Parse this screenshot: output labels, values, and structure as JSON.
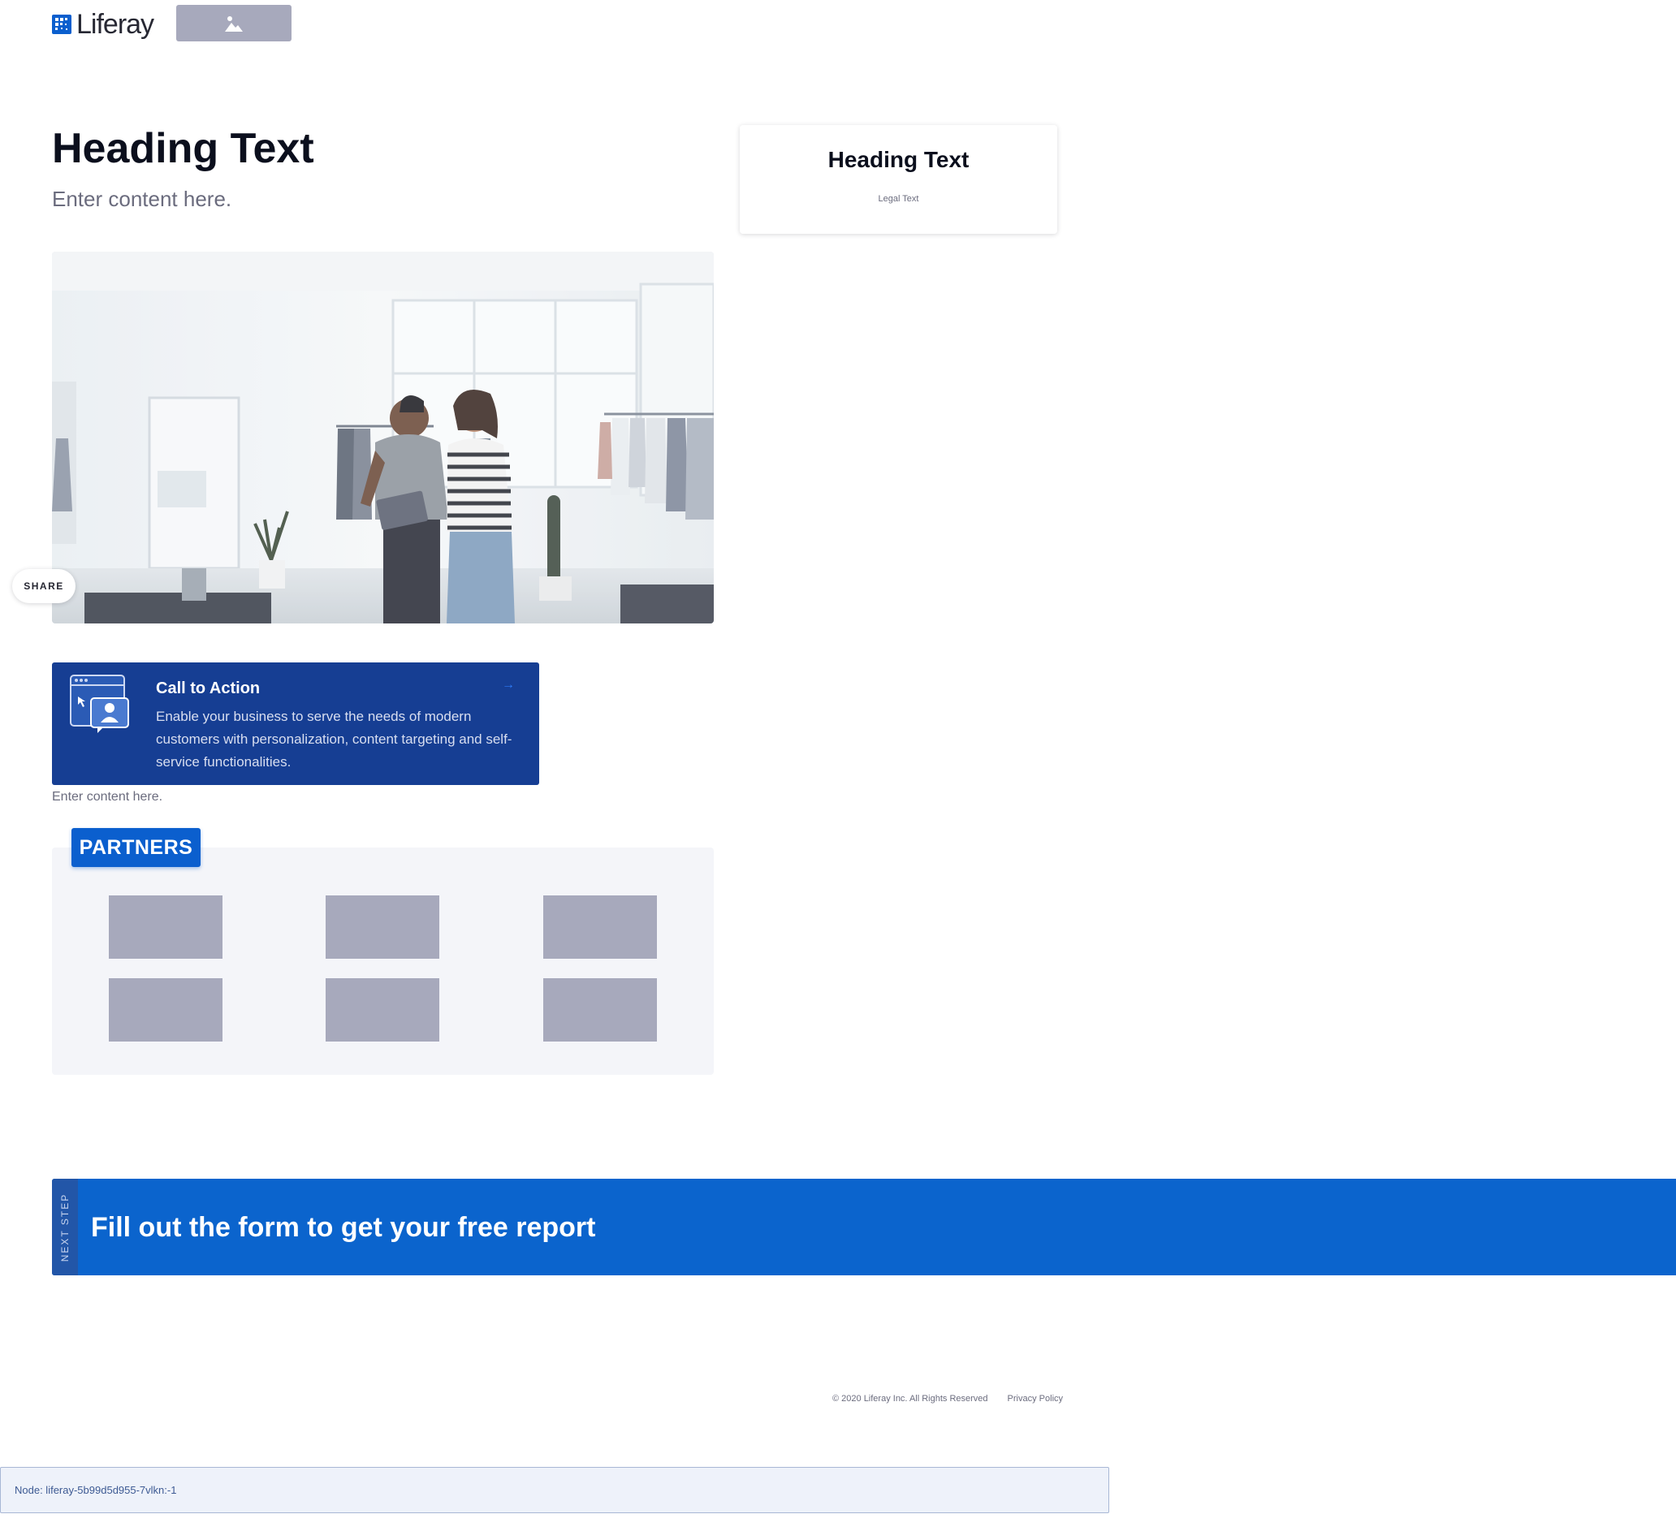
{
  "header": {
    "logo_text": "Liferay",
    "logo_icon": "liferay-logo-icon",
    "image_placeholder_icon": "image-icon"
  },
  "hero": {
    "heading": "Heading Text",
    "content": "Enter content here."
  },
  "card": {
    "heading": "Heading Text",
    "legal": "Legal Text"
  },
  "share": {
    "label": "SHARE"
  },
  "cta": {
    "title": "Call to Action",
    "text": "Enable your business to serve the needs of modern customers with personalization, content targeting and self-service functionalities.",
    "arrow": "→",
    "icon": "user-window-illustration"
  },
  "content_small": "Enter content here.",
  "partners": {
    "label": "PARTNERS",
    "logos": [
      "partner-logo-1",
      "partner-logo-2",
      "partner-logo-3",
      "partner-logo-4",
      "partner-logo-5",
      "partner-logo-6"
    ]
  },
  "banner": {
    "side_label": "NEXT STEP",
    "title": "Fill out the form to get your free report"
  },
  "footer": {
    "copyright": "© 2020 Liferay Inc. All Rights Reserved",
    "privacy": "Privacy Policy"
  },
  "node": {
    "text": "Node: liferay-5b99d5d955-7vlkn:-1"
  },
  "colors": {
    "brand_blue": "#0b5fce",
    "cta_bg": "#163e93",
    "banner_bg": "#0b64cd",
    "placeholder": "#a7a9bc",
    "panel_bg": "#f4f5f9"
  }
}
